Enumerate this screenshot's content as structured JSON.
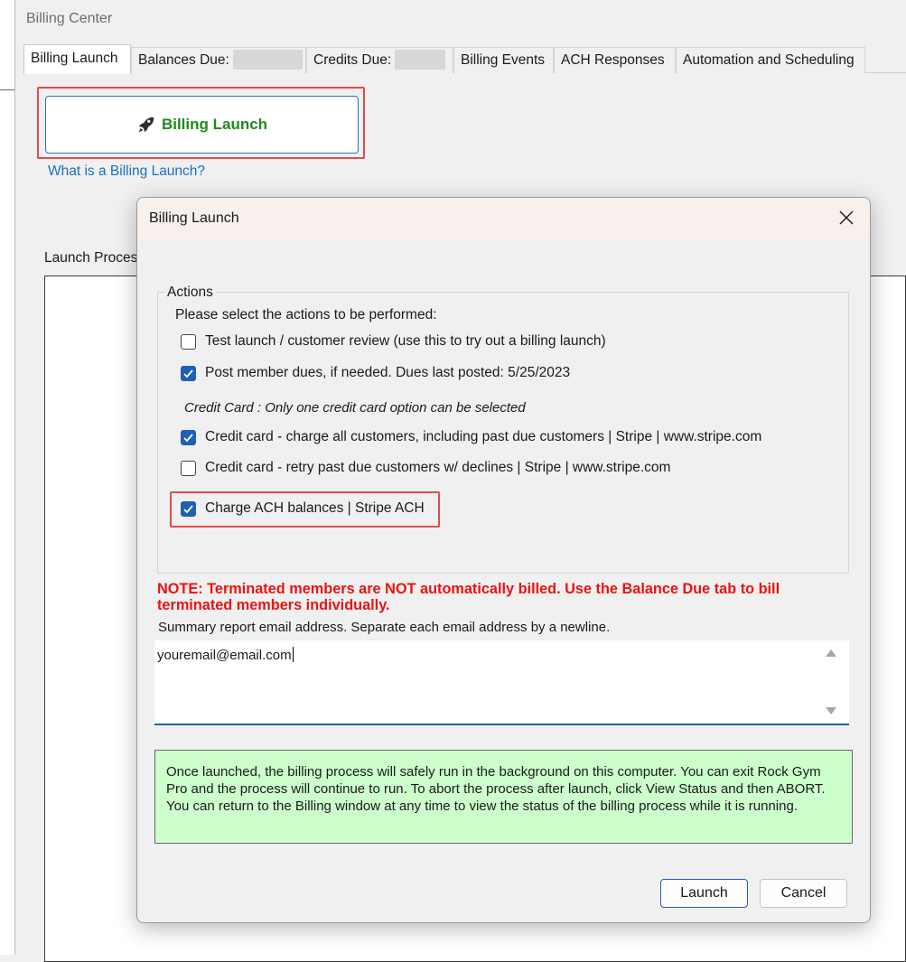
{
  "window": {
    "title": "Billing Center"
  },
  "tabs": [
    {
      "label": "Billing Launch",
      "active": true
    },
    {
      "label": "Balances Due:",
      "redacted": true
    },
    {
      "label": "Credits Due:",
      "redacted": true
    },
    {
      "label": "Billing Events"
    },
    {
      "label": "ACH Responses"
    },
    {
      "label": "Automation and Scheduling"
    }
  ],
  "billing_launch_panel": {
    "launch_button_label": "Billing Launch",
    "help_link": "What is a Billing Launch?",
    "launch_process_label": "Launch Proces"
  },
  "dialog": {
    "title": "Billing Launch",
    "actions_group_label": "Actions",
    "instruction": "Please select the actions to be performed:",
    "options": [
      {
        "label": "Test launch / customer review (use this to try out a billing launch)",
        "checked": false
      },
      {
        "label": "Post member dues, if needed.  Dues last posted: 5/25/2023",
        "checked": true
      },
      {
        "label": "Credit card - charge all customers, including past due customers | Stripe | www.stripe.com",
        "checked": true
      },
      {
        "label": "Credit card - retry past due customers w/ declines | Stripe | www.stripe.com",
        "checked": false
      },
      {
        "label": "Charge ACH balances | Stripe ACH",
        "checked": true,
        "highlighted": true
      }
    ],
    "credit_card_subheading": "Credit Card : Only one credit card option can be selected",
    "note": "NOTE: Terminated members are NOT automatically billed. Use the Balance Due tab to bill terminated members individually.",
    "email_label": "Summary report email address.  Separate each email address by a newline.",
    "email_value": "youremail@email.com",
    "info_text": "Once launched, the billing process will safely run in the background on this computer.  You can exit Rock Gym Pro and the process will continue to run.  To abort the process after launch, click View Status and then ABORT.  You can return to the Billing window at any time to view the status of the billing process while it is running.",
    "launch_button": "Launch",
    "cancel_button": "Cancel"
  },
  "colors": {
    "accent": "#1f5fb4",
    "note_red": "#ee1111",
    "launch_green": "#1f8a1f",
    "highlight_red": "#e24b4b",
    "info_green_bg": "#ccffcc",
    "link_blue": "#1a6fc1"
  },
  "icons": [
    "rocket-icon",
    "close-icon",
    "checkbox-icon",
    "scroll-up-icon",
    "scroll-down-icon"
  ]
}
